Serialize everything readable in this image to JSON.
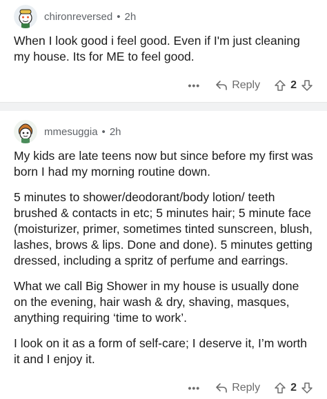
{
  "comments": [
    {
      "username": "chironreversed",
      "separator": "•",
      "time": "2h",
      "paragraphs": [
        "When I look good i feel good. Even if I'm just cleaning my house. Its for ME to feel good."
      ],
      "more": "•••",
      "reply_label": "Reply",
      "votes": "2",
      "avatar_icon": "snoo-avatar-icon"
    },
    {
      "username": "mmesuggia",
      "separator": "•",
      "time": "2h",
      "paragraphs": [
        "My kids are late teens now but since before my first was born I had my morning routine down.",
        "5 minutes to shower/deodorant/body lotion/ teeth brushed & contacts in etc; 5 minutes hair; 5 minute face (moisturizer, primer, sometimes tinted sunscreen, blush, lashes, brows & lips. Done and done). 5 minutes getting dressed, including a spritz of perfume and earrings.",
        "What we call Big Shower in my house is usually done on the evening, hair wash & dry, shaving, masques, anything requiring ‘time to work’.",
        "I look on it as a form of self-care; I deserve it, I’m worth it and I enjoy it."
      ],
      "more": "•••",
      "reply_label": "Reply",
      "votes": "2",
      "avatar_icon": "snoo-avatar-icon"
    }
  ],
  "colors": {
    "meta_text": "#5f6368",
    "body_text": "#1c1c1c",
    "separator_bg": "#f1f2f3"
  }
}
